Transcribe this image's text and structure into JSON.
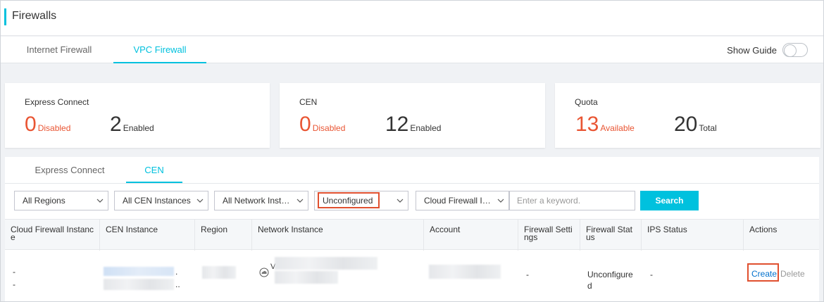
{
  "header": {
    "title": "Firewalls"
  },
  "tabs": [
    {
      "label": "Internet Firewall",
      "active": false
    },
    {
      "label": "VPC Firewall",
      "active": true
    }
  ],
  "guide": {
    "label": "Show Guide",
    "on": false
  },
  "cards": [
    {
      "title": "Express Connect",
      "stats": [
        {
          "value": "0",
          "label": "Disabled",
          "color": "#e95533"
        },
        {
          "value": "2",
          "label": "Enabled",
          "color": "#333333"
        }
      ]
    },
    {
      "title": "CEN",
      "stats": [
        {
          "value": "0",
          "label": "Disabled",
          "color": "#e95533"
        },
        {
          "value": "12",
          "label": "Enabled",
          "color": "#333333"
        }
      ]
    },
    {
      "title": "Quota",
      "stats": [
        {
          "value": "13",
          "label": "Available",
          "color": "#e95533"
        },
        {
          "value": "20",
          "label": "Total",
          "color": "#333333"
        }
      ]
    }
  ],
  "subtabs": [
    {
      "label": "Express Connect",
      "active": false
    },
    {
      "label": "CEN",
      "active": true
    }
  ],
  "filters": {
    "regions": "All Regions",
    "cen_instances": "All CEN Instances",
    "network_instances": "All Network Inst…",
    "status": "Unconfigured",
    "field": "Cloud Firewall I…",
    "keyword_placeholder": "Enter a keyword.",
    "search_label": "Search"
  },
  "columns": {
    "cloud_firewall_instance": "Cloud Firewall Instanc\ne",
    "cen_instance": "CEN Instance",
    "region": "Region",
    "network_instance": "Network Instance",
    "account": "Account",
    "firewall_settings": "Firewall Setti\nngs",
    "firewall_status": "Firewall Stat\nus",
    "ips_status": "IPS Status",
    "actions": "Actions"
  },
  "row": {
    "instance_line1": "-",
    "instance_line2": "-",
    "cen_dot1": ".",
    "cen_dot2": "..",
    "network_prefix": "V",
    "firewall_settings": "-",
    "status": "Unconfigure\nd",
    "ips_status": "-",
    "create_label": "Create",
    "delete_label": "Delete"
  },
  "colors": {
    "accent": "#00c1de",
    "alert": "#e95533",
    "highlight_box": "#e0502f",
    "link": "#0070cc"
  }
}
